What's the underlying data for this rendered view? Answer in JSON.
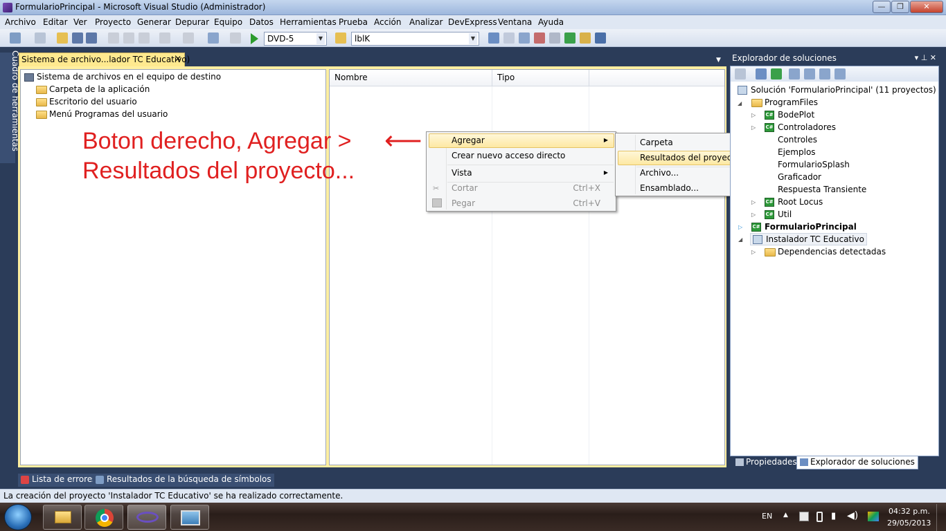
{
  "window": {
    "title": "FormularioPrincipal - Microsoft Visual Studio (Administrador)",
    "minimize": "—",
    "maximize": "❐",
    "close": "✕"
  },
  "menu": [
    "Archivo",
    "Editar",
    "Ver",
    "Proyecto",
    "Generar",
    "Depurar",
    "Equipo",
    "Datos",
    "Herramientas",
    "Prueba",
    "Acción",
    "Analizar",
    "DevExpress",
    "Ventana",
    "Ayuda"
  ],
  "toolbar": {
    "config_value": "DVD-5",
    "find_value": "lblK"
  },
  "toolbox_tab": "Cuadro de herramientas",
  "doc_tab": {
    "label": "Sistema de archivo...lador TC Educativo)",
    "close": "✕"
  },
  "file_tree": {
    "root": "Sistema de archivos en el equipo de destino",
    "items": [
      "Carpeta de la aplicación",
      "Escritorio del usuario",
      "Menú Programas del usuario"
    ]
  },
  "columns": [
    "Nombre",
    "Tipo"
  ],
  "annotation": {
    "line1": "Boton derecho, Agregar >",
    "line2": "Resultados del proyecto...",
    "arrow": "⟵"
  },
  "context_menu": {
    "items": [
      {
        "label": "Agregar",
        "shortcut": "",
        "submenu": true,
        "enabled": true
      },
      {
        "label": "Crear nuevo acceso directo",
        "shortcut": "",
        "submenu": false,
        "enabled": true
      },
      {
        "label": "Vista",
        "shortcut": "",
        "submenu": true,
        "enabled": true
      },
      {
        "label": "Cortar",
        "shortcut": "Ctrl+X",
        "submenu": false,
        "enabled": false
      },
      {
        "label": "Pegar",
        "shortcut": "Ctrl+V",
        "submenu": false,
        "enabled": false
      }
    ]
  },
  "submenu": {
    "items": [
      "Carpeta",
      "Resultados del proyecto...",
      "Archivo...",
      "Ensamblado..."
    ]
  },
  "solution_explorer": {
    "title": "Explorador de soluciones",
    "title_buttons": "▾ ⊥ ✕",
    "solution": "Solución 'FormularioPrincipal'  (11 proyectos)",
    "program_files": "ProgramFiles",
    "projects": [
      "BodePlot",
      "Controladores",
      "Controles",
      "Ejemplos",
      "FormularioSplash",
      "Graficador",
      "Respuesta Transiente",
      "Root Locus",
      "Util"
    ],
    "startup_project": "FormularioPrincipal",
    "installer": "Instalador TC Educativo",
    "dependencies": "Dependencias detectadas"
  },
  "right_tabs": [
    "Propiedades",
    "Explorador de soluciones"
  ],
  "bottom_tabs": [
    "Lista de errores",
    "Resultados de la búsqueda de símbolos"
  ],
  "status": "La creación del proyecto 'Instalador TC Educativo' se ha realizado correctamente.",
  "tray": {
    "lang": "EN",
    "time": "04:32 p.m.",
    "date": "29/05/2013"
  },
  "colors": {
    "frame": "#2b3c59",
    "doc_tab": "#ffe98f",
    "annotation": "#e02020",
    "highlight": "#fde8a3"
  }
}
